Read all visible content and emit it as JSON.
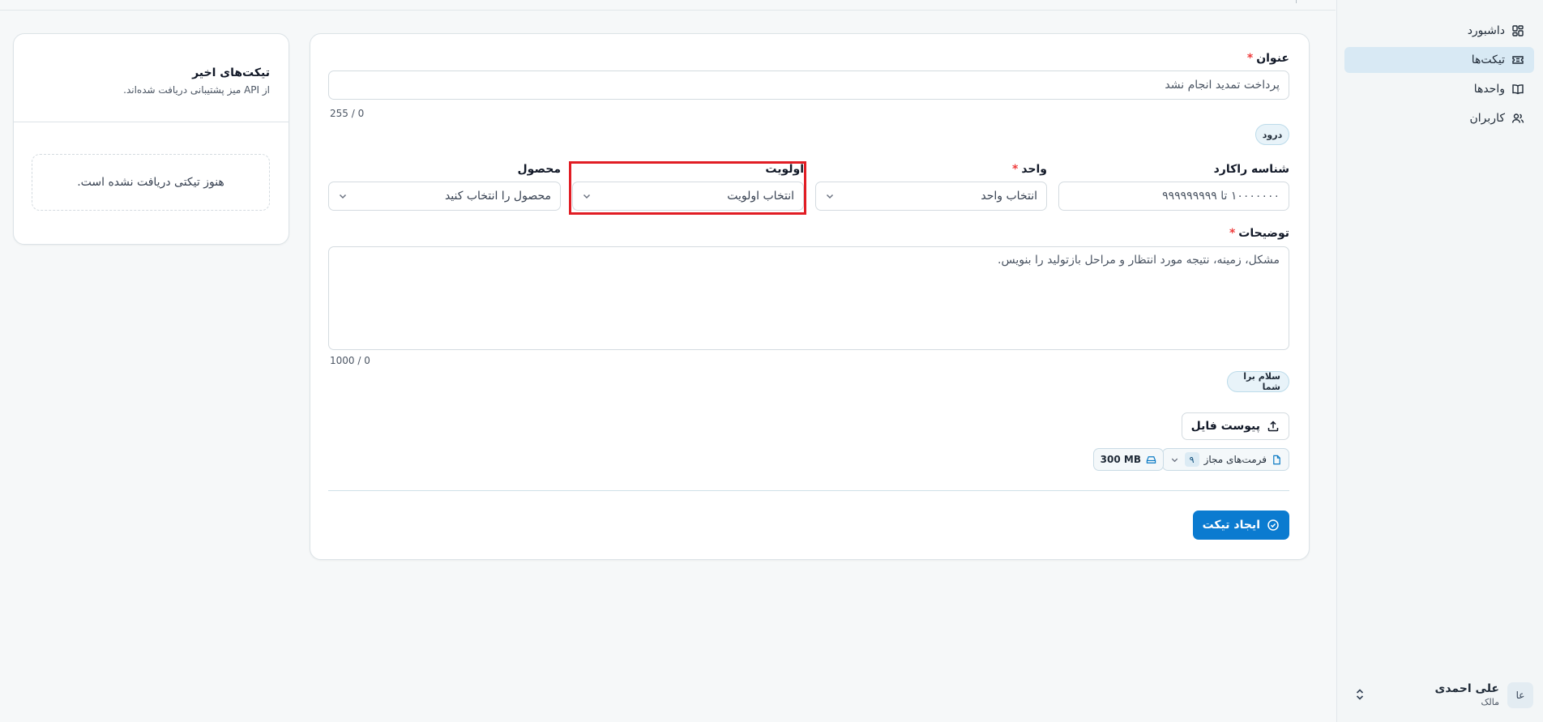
{
  "sidebar": {
    "items": [
      {
        "label": "داشبورد",
        "icon": "dashboard-icon",
        "active": false
      },
      {
        "label": "تیکت‌ها",
        "icon": "ticket-icon",
        "active": true
      },
      {
        "label": "واحدها",
        "icon": "book-icon",
        "active": false
      },
      {
        "label": "کاربران",
        "icon": "users-icon",
        "active": false
      }
    ],
    "user": {
      "initials": "عا",
      "name": "علی احمدی",
      "role": "مالک"
    }
  },
  "form": {
    "title_label": "عنوان",
    "required_mark": "*",
    "title_value": "پرداخت تمدید انجام نشد",
    "title_counter": "255 / 0",
    "title_chip": "درود",
    "rakard_label": "شناسه راکارد",
    "rakard_placeholder": "۱۰۰۰۰۰۰۰ تا ۹۹۹۹۹۹۹۹۹",
    "unit_label": "واحد",
    "unit_placeholder": "انتخاب واحد",
    "priority_label": "اولویت",
    "priority_placeholder": "انتخاب اولویت",
    "product_label": "محصول",
    "product_placeholder": "محصول را انتخاب کنید",
    "desc_label": "توضیحات",
    "desc_placeholder": "مشکل، زمینه، نتیجه مورد انتظار و مراحل بازتولید را بنویس.",
    "desc_counter": "1000 / 0",
    "desc_chip": "سلام برا شما",
    "attach_label": "پیوست فایل",
    "formats_label": "فرمت‌های مجاز",
    "formats_count": "۹",
    "size_limit": "300 MB",
    "submit_label": "ایجاد تیکت"
  },
  "recent": {
    "title": "تیکت‌های اخیر",
    "subtitle": "از API میز پشتیبانی دریافت شده‌اند.",
    "empty": "هنوز تیکتی دریافت نشده است."
  },
  "colors": {
    "accent": "#0b7bd0",
    "highlight": "#e11d24",
    "required": "#ef3b3b"
  }
}
